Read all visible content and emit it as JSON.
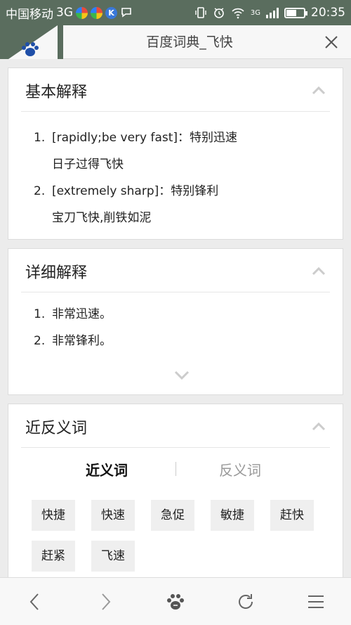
{
  "status_bar": {
    "carrier": "中国移动",
    "network": "3G",
    "network_small": "3G",
    "time": "20:35",
    "battery_level": 0.55,
    "icons": [
      "app-icon-a",
      "app-icon-b",
      "app-icon-k",
      "chat-icon",
      "vibrate-icon",
      "alarm-icon",
      "wifi-icon",
      "signal-icon",
      "battery-icon"
    ]
  },
  "title_bar": {
    "title": "百度词典_飞快",
    "icons": [
      "paw-logo-icon",
      "close-icon"
    ]
  },
  "basic": {
    "title": "基本解释",
    "items": [
      {
        "num": "1.",
        "text": "[rapidly;be very fast]：特别迅速",
        "example": "日子过得飞快"
      },
      {
        "num": "2.",
        "text": "[extremely sharp]：特别锋利",
        "example": "宝刀飞快,削铁如泥"
      }
    ]
  },
  "detail": {
    "title": "详细解释",
    "items": [
      {
        "num": "1.",
        "text": "非常迅速。"
      },
      {
        "num": "2.",
        "text": "非常锋利。"
      }
    ]
  },
  "synonyms": {
    "title": "近反义词",
    "tab_synonym": "近义词",
    "tab_antonym": "反义词",
    "chips": [
      "快捷",
      "快速",
      "急促",
      "敏捷",
      "赶快",
      "赶紧",
      "飞速"
    ]
  },
  "bottom_bar": {
    "icons": [
      "back-icon",
      "forward-icon",
      "baidu-home-icon",
      "refresh-icon",
      "menu-icon"
    ]
  },
  "colors": {
    "status_bg": "#5a6d5e",
    "accent_text": "#222222",
    "muted": "#999999"
  }
}
